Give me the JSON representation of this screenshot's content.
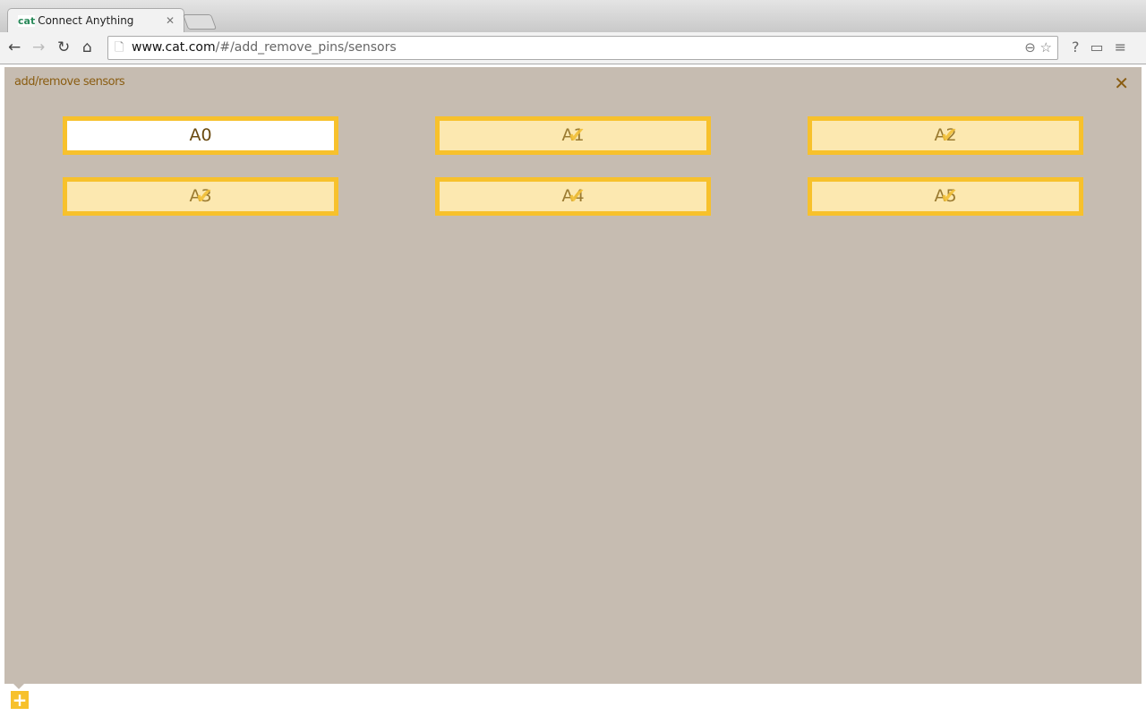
{
  "browser": {
    "tab_title": "Connect Anything",
    "favicon_text": "cat",
    "url_host": "www.cat.com",
    "url_path": "/#/add_remove_pins/sensors"
  },
  "panel": {
    "title": "add/remove sensors",
    "close_icon": "close-icon",
    "pins": [
      {
        "label": "A0",
        "selected": false
      },
      {
        "label": "A1",
        "selected": true
      },
      {
        "label": "A2",
        "selected": true
      },
      {
        "label": "A3",
        "selected": true
      },
      {
        "label": "A4",
        "selected": true
      },
      {
        "label": "A5",
        "selected": true
      }
    ]
  },
  "colors": {
    "accent": "#f7c12c",
    "panel": "#c6bcb1",
    "text": "#8a5d12"
  },
  "footer": {
    "add_icon": "plus-icon"
  }
}
